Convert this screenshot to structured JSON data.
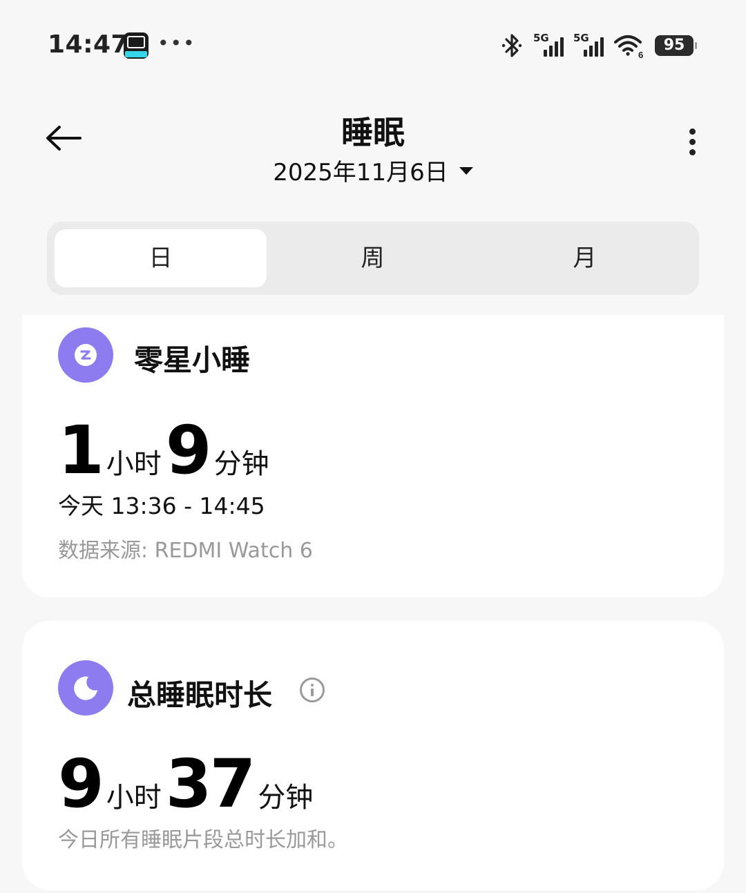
{
  "status_bar": {
    "time": "14:47",
    "more": "•••",
    "network1": "5G",
    "network2": "5G",
    "wifi_badge": "6",
    "battery": "95"
  },
  "header": {
    "title": "睡眠",
    "date": "2025年11月6日"
  },
  "tabs": [
    {
      "label": "日",
      "active": true
    },
    {
      "label": "周",
      "active": false
    },
    {
      "label": "月",
      "active": false
    }
  ],
  "nap_card": {
    "title": "零星小睡",
    "hours": "1",
    "hours_unit": "小时",
    "minutes": "9",
    "minutes_unit": "分钟",
    "time_range": "今天 13:36 - 14:45",
    "source": "数据来源: REDMI Watch 6"
  },
  "total_card": {
    "title": "总睡眠时长",
    "hours": "9",
    "hours_unit": "小时",
    "minutes": "37",
    "minutes_unit": "分钟",
    "description": "今日所有睡眠片段总时长加和。"
  },
  "colors": {
    "accent_purple": "#8c7cf0",
    "background": "#f7f7f7"
  }
}
